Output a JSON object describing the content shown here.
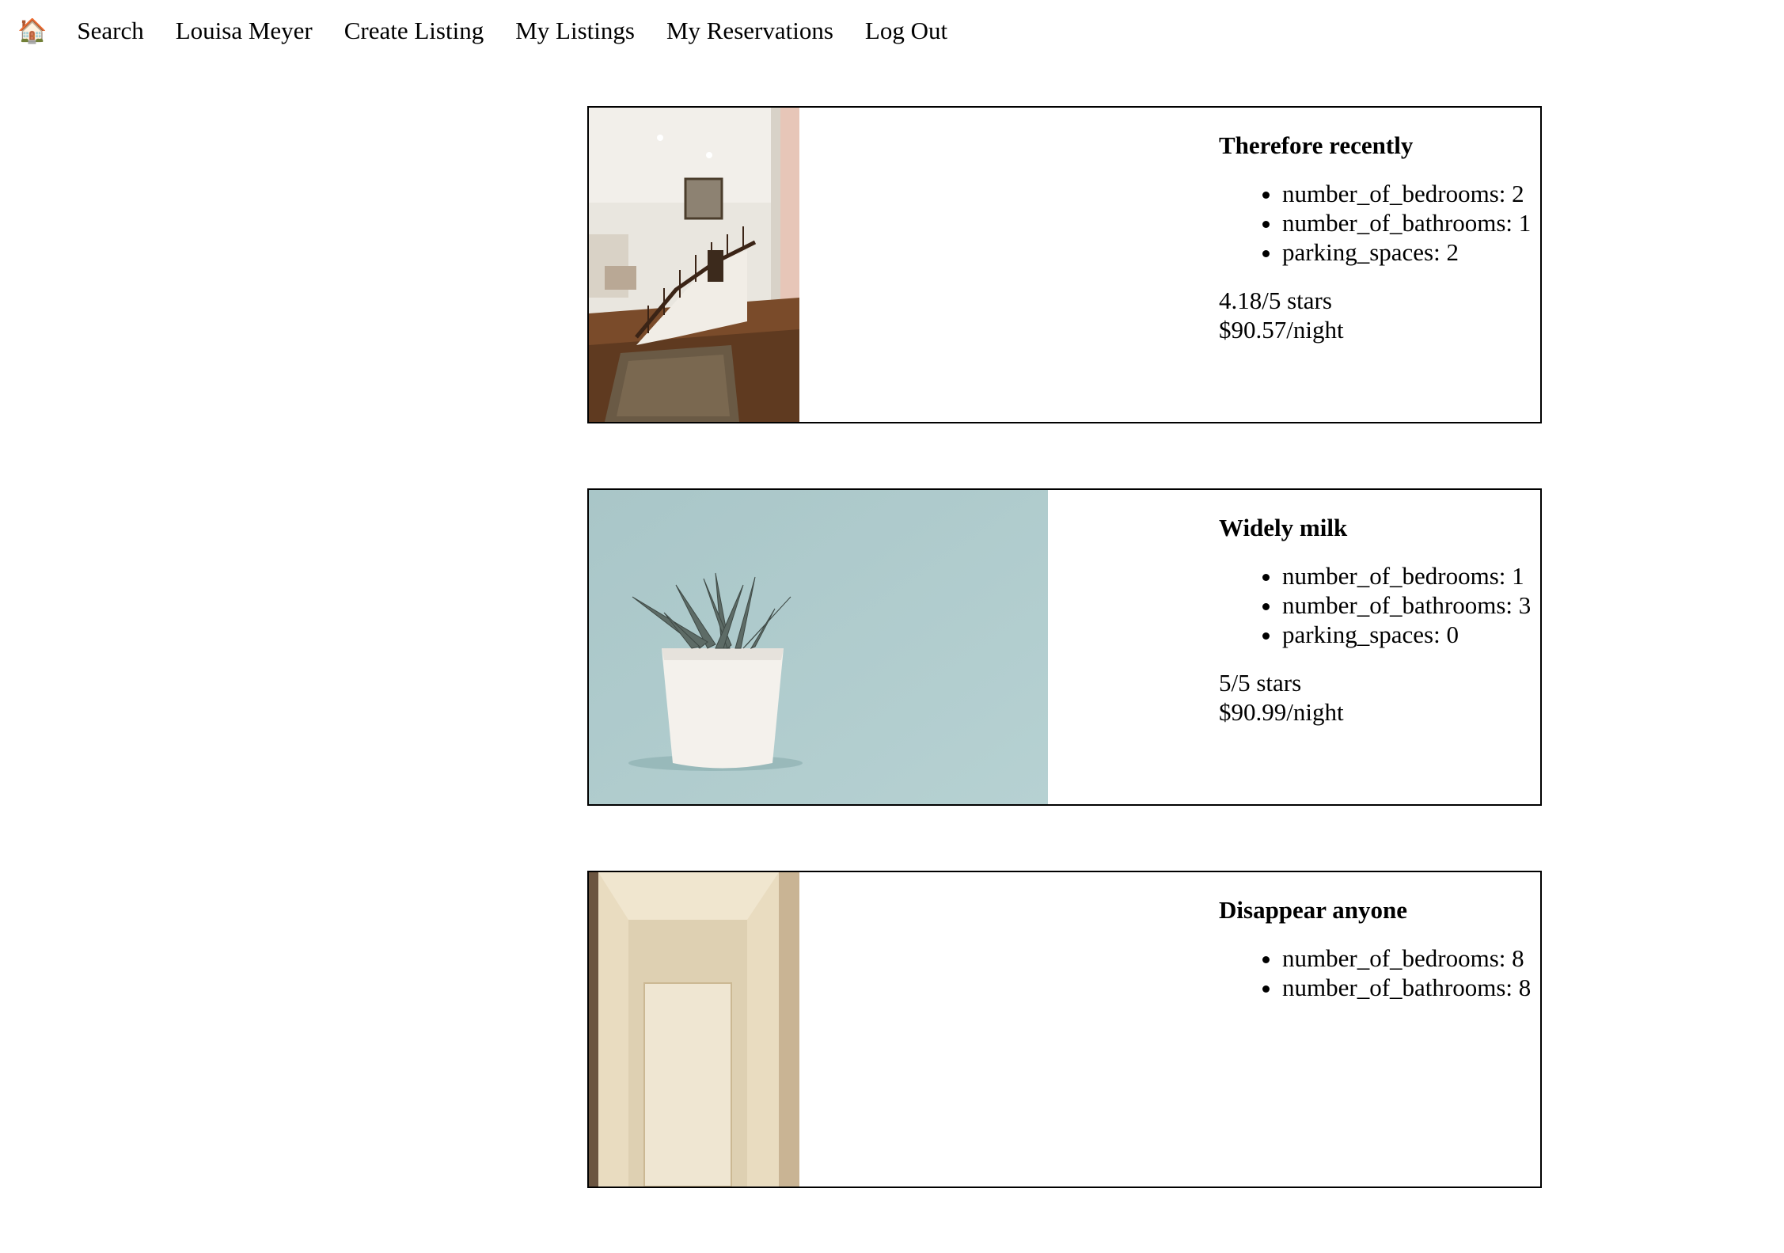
{
  "nav": {
    "home_icon": "house-icon",
    "home_glyph": "🏠",
    "items": [
      {
        "label": "Search"
      },
      {
        "label": "Louisa Meyer"
      },
      {
        "label": "Create Listing"
      },
      {
        "label": "My Listings"
      },
      {
        "label": "My Reservations"
      },
      {
        "label": "Log Out"
      }
    ]
  },
  "listings": [
    {
      "title": "Therefore recently",
      "image": "staircase-interior-photo",
      "features": [
        "number_of_bedrooms: 2",
        "number_of_bathrooms: 1",
        "parking_spaces: 2"
      ],
      "rating": "4.18/5 stars",
      "price": "$90.57/night"
    },
    {
      "title": "Widely milk",
      "image": "potted-succulent-photo",
      "features": [
        "number_of_bedrooms: 1",
        "number_of_bathrooms: 3",
        "parking_spaces: 0"
      ],
      "rating": "5/5 stars",
      "price": "$90.99/night"
    },
    {
      "title": "Disappear anyone",
      "image": "hallway-ceiling-light-photo",
      "features": [
        "number_of_bedrooms: 8",
        "number_of_bathrooms: 8"
      ],
      "rating": "",
      "price": ""
    }
  ]
}
